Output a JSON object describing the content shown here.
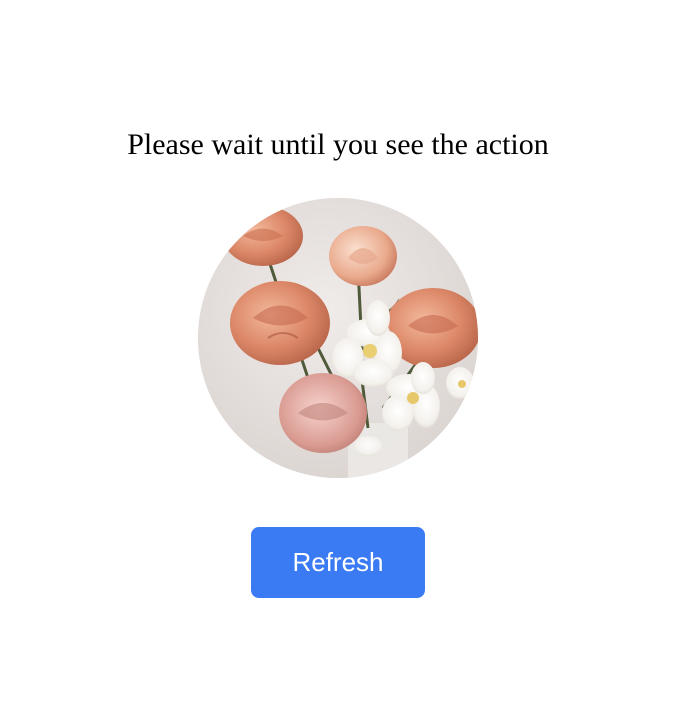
{
  "heading": "Please wait until you see the action",
  "image": {
    "alt": "Bouquet of peach roses and white flowers"
  },
  "refresh_button": {
    "label": "Refresh"
  },
  "colors": {
    "button_background": "#3a7bf3",
    "button_text": "#ffffff",
    "heading_text": "#000000",
    "page_background": "#ffffff"
  }
}
